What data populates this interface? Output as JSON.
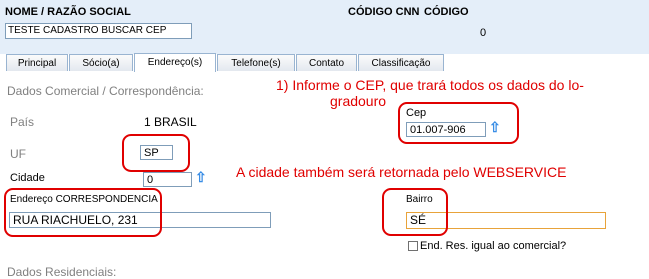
{
  "header": {
    "name_label": "NOME / RAZÃO SOCIAL",
    "cnn_label": "CÓDIGO CNN",
    "code_label": "CÓDIGO",
    "name_value": "TESTE CADASTRO BUSCAR CEP",
    "code_value": "0"
  },
  "tabs": [
    {
      "label": "Principal"
    },
    {
      "label": "Sócio(a)"
    },
    {
      "label": "Endereço(s)"
    },
    {
      "label": "Telefone(s)"
    },
    {
      "label": "Contato"
    },
    {
      "label": "Classificação"
    }
  ],
  "active_tab": "Endereço(s)",
  "form": {
    "section_title": "Dados Comercial / Correspondência:",
    "pais_label": "País",
    "pais_value": "1 BRASIL",
    "uf_label": "UF",
    "uf_value": "SP",
    "cidade_label": "Cidade",
    "cidade_value": "0",
    "cep_label": "Cep",
    "cep_value": "01.007-906",
    "endereco_label": "Endereço CORRESPONDENCIA",
    "endereco_value": "RUA RIACHUELO, 231",
    "bairro_label": "Bairro",
    "bairro_value": "SÉ",
    "checkbox_label": "End. Res. igual ao comercial?",
    "next_section": "Dados Residenciais:"
  },
  "annotations": {
    "note1_line1": "1) Informe o CEP, que trará todos os dados do lo-",
    "note1_line2": "gradouro",
    "note2": "A cidade também será retornada pelo WEBSERVICE"
  },
  "colors": {
    "annotation": "#e00000",
    "top_bar": "#e4eef9",
    "arrow_icon": "#3a8ee6",
    "bairro_border": "#e8a33a"
  },
  "icons": {
    "cep_search": "arrow-up-icon",
    "cidade_search": "arrow-up-icon"
  }
}
